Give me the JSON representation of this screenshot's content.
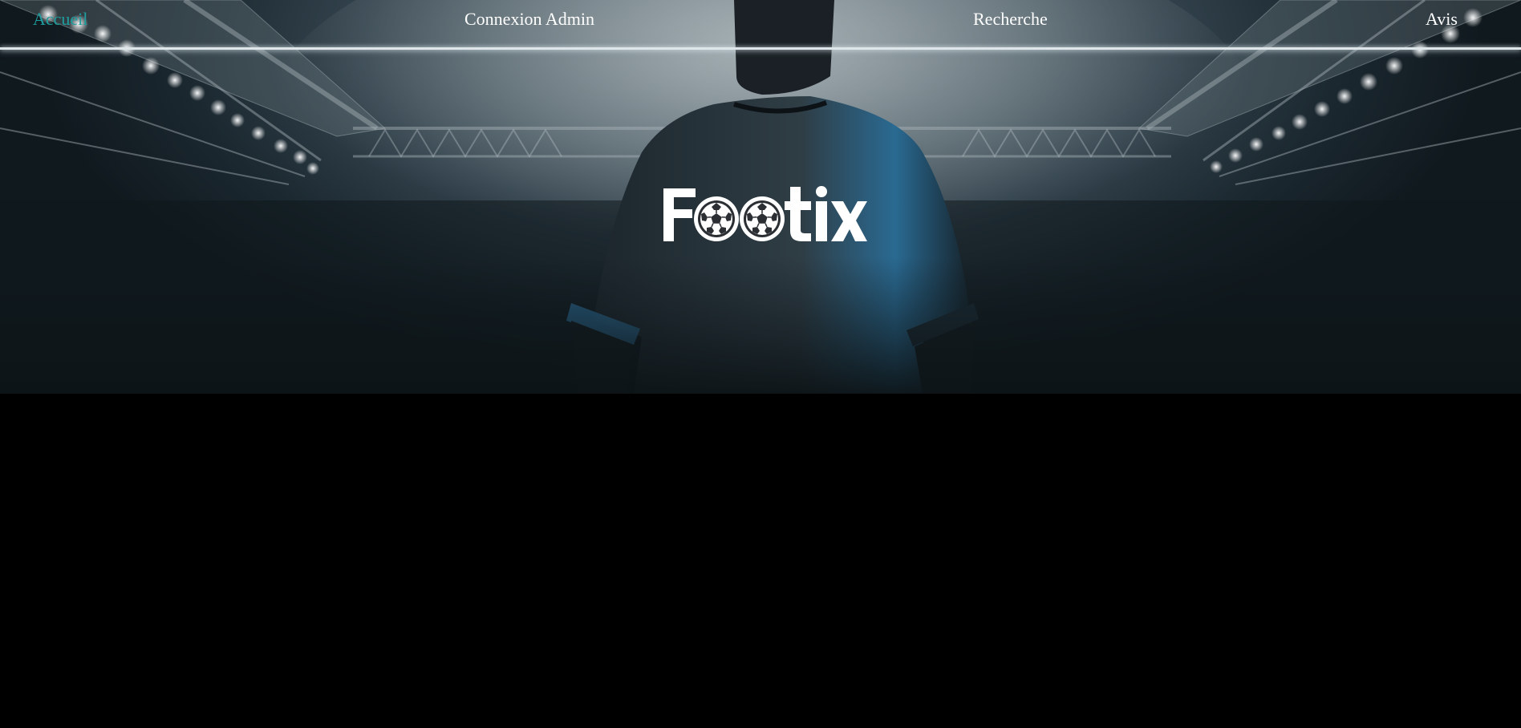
{
  "nav": {
    "items": [
      {
        "label": "Accueil",
        "active": true
      },
      {
        "label": "Connexion Admin",
        "active": false
      },
      {
        "label": "Recherche",
        "active": false
      },
      {
        "label": "Avis",
        "active": false
      }
    ]
  },
  "hero": {
    "logo_text": "Footix",
    "background": "soccer player in stadium"
  },
  "colors": {
    "active_link": "#1e9e9e",
    "link": "#ffffff",
    "page_bg": "#000000"
  }
}
